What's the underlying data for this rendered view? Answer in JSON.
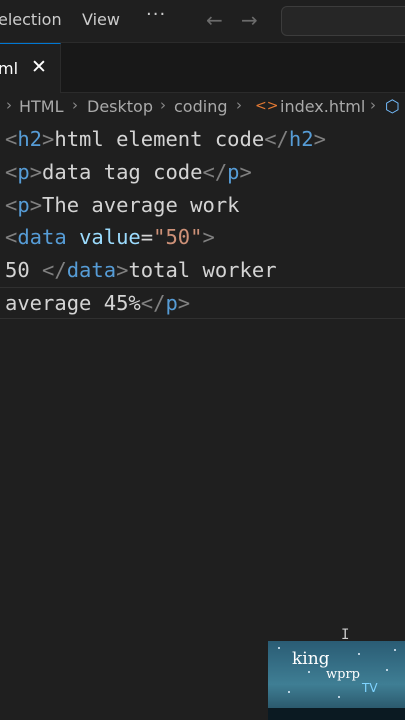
{
  "menu": {
    "selection_label": "election",
    "view_label": "View",
    "more_label": "···"
  },
  "navigation": {
    "back_icon": "arrow-left-icon",
    "forward_icon": "arrow-right-icon",
    "back_glyph": "←",
    "forward_glyph": "→"
  },
  "tabs": [
    {
      "label": "ml",
      "close_glyph": "✕",
      "active": true
    }
  ],
  "breadcrumb": {
    "items": [
      "HTML",
      "Desktop",
      "coding",
      "index.html"
    ],
    "separator": "›",
    "file_icon_glyph": "<>",
    "symbol_icon_glyph": "⬡"
  },
  "editor": {
    "lines": [
      [
        [
          "tag-bracket",
          "<"
        ],
        [
          "tag-name",
          "h2"
        ],
        [
          "tag-bracket",
          ">"
        ],
        [
          "text",
          "html element code"
        ],
        [
          "tag-bracket",
          "</"
        ],
        [
          "tag-name",
          "h2"
        ],
        [
          "tag-bracket",
          ">"
        ]
      ],
      [
        [
          "tag-bracket",
          "<"
        ],
        [
          "tag-name",
          "p"
        ],
        [
          "tag-bracket",
          ">"
        ],
        [
          "text",
          "data tag code"
        ],
        [
          "tag-bracket",
          "</"
        ],
        [
          "tag-name",
          "p"
        ],
        [
          "tag-bracket",
          ">"
        ]
      ],
      [
        [
          "tag-bracket",
          "<"
        ],
        [
          "tag-name",
          "p"
        ],
        [
          "tag-bracket",
          ">"
        ],
        [
          "text",
          "The average work"
        ]
      ],
      [
        [
          "tag-bracket",
          "<"
        ],
        [
          "tag-name",
          "data"
        ],
        [
          "text",
          " "
        ],
        [
          "attr-name",
          "value"
        ],
        [
          "text",
          "="
        ],
        [
          "attr-value",
          "\"50\""
        ],
        [
          "tag-bracket",
          ">"
        ]
      ],
      [
        [
          "text",
          "50 "
        ],
        [
          "tag-bracket",
          "</"
        ],
        [
          "tag-name",
          "data"
        ],
        [
          "tag-bracket",
          ">"
        ],
        [
          "text",
          "total worker"
        ]
      ],
      [
        [
          "text",
          "average 45%"
        ],
        [
          "tag-bracket",
          "</"
        ],
        [
          "tag-name",
          "p"
        ],
        [
          "tag-bracket",
          ">"
        ]
      ]
    ]
  },
  "watermark": {
    "line1": "king",
    "line2": "wprp",
    "line3": "TV"
  },
  "colors": {
    "tag": "#569cd6",
    "attribute": "#9cdcfe",
    "string": "#ce9178",
    "bracket": "#808080",
    "accent": "#0078d4"
  }
}
